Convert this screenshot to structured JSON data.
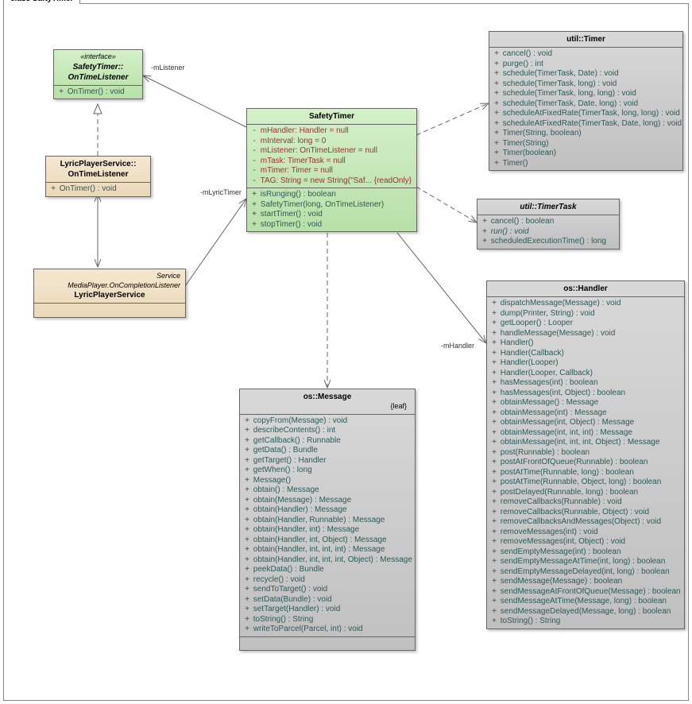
{
  "diagram_title": "class SaftyTimer",
  "classes": {
    "ontime": {
      "stereo": "«interface»",
      "name": "SafetyTimer::\nOnTimeListener",
      "ops": [
        "OnTimer() : void"
      ]
    },
    "lyriclistener": {
      "name": "LyricPlayerService::\nOnTimeListener",
      "ops": [
        "OnTimer() : void"
      ]
    },
    "safetytimer": {
      "name": "SafetyTimer",
      "attrs": [
        "mHandler:  Handler = null",
        "mInterval:  long = 0",
        "mListener:  OnTimeListener = null",
        "mTask:  TimerTask = null",
        "mTimer:  Timer = null",
        "TAG:  String = new String(\"Saf...  {readOnly}"
      ],
      "ops": [
        "isRunging() : boolean",
        "SafetyTimer(long, OnTimeListener)",
        "startTimer() : void",
        "stopTimer() : void"
      ]
    },
    "lyricservice": {
      "stereo": "Service\nMediaPlayer.OnCompletionListener",
      "name": "LyricPlayerService"
    },
    "timer": {
      "name": "util::Timer",
      "ops": [
        "cancel() : void",
        "purge() : int",
        "schedule(TimerTask, Date) : void",
        "schedule(TimerTask, long) : void",
        "schedule(TimerTask, long, long) : void",
        "schedule(TimerTask, Date, long) : void",
        "scheduleAtFixedRate(TimerTask, long, long) : void",
        "scheduleAtFixedRate(TimerTask, Date, long) : void",
        "Timer(String, boolean)",
        "Timer(String)",
        "Timer(boolean)",
        "Timer()"
      ]
    },
    "timertask": {
      "name": "util::TimerTask",
      "ops": [
        "cancel() : boolean",
        "run() : void",
        "scheduledExecutionTime() : long"
      ]
    },
    "handler": {
      "name": "os::Handler",
      "ops": [
        "dispatchMessage(Message) : void",
        "dump(Printer, String) : void",
        "getLooper() : Looper",
        "handleMessage(Message) : void",
        "Handler()",
        "Handler(Callback)",
        "Handler(Looper)",
        "Handler(Looper, Callback)",
        "hasMessages(int) : boolean",
        "hasMessages(int, Object) : boolean",
        "obtainMessage() : Message",
        "obtainMessage(int) : Message",
        "obtainMessage(int, Object) : Message",
        "obtainMessage(int, int, int) : Message",
        "obtainMessage(int, int, int, Object) : Message",
        "post(Runnable) : boolean",
        "postAtFrontOfQueue(Runnable) : boolean",
        "postAtTime(Runnable, long) : boolean",
        "postAtTime(Runnable, Object, long) : boolean",
        "postDelayed(Runnable, long) : boolean",
        "removeCallbacks(Runnable) : void",
        "removeCallbacks(Runnable, Object) : void",
        "removeCallbacksAndMessages(Object) : void",
        "removeMessages(int) : void",
        "removeMessages(int, Object) : void",
        "sendEmptyMessage(int) : boolean",
        "sendEmptyMessageAtTime(int, long) : boolean",
        "sendEmptyMessageDelayed(int, long) : boolean",
        "sendMessage(Message) : boolean",
        "sendMessageAtFrontOfQueue(Message) : boolean",
        "sendMessageAtTime(Message, long) : boolean",
        "sendMessageDelayed(Message, long) : boolean",
        "toString() : String"
      ]
    },
    "message": {
      "name": "os::Message",
      "leaf": "{leaf}",
      "ops": [
        "copyFrom(Message) : void",
        "describeContents() : int",
        "getCallback() : Runnable",
        "getData() : Bundle",
        "getTarget() : Handler",
        "getWhen() : long",
        "Message()",
        "obtain() : Message",
        "obtain(Message) : Message",
        "obtain(Handler) : Message",
        "obtain(Handler, Runnable) : Message",
        "obtain(Handler, int) : Message",
        "obtain(Handler, int, Object) : Message",
        "obtain(Handler, int, int, int) : Message",
        "obtain(Handler, int, int, int, Object) : Message",
        "peekData() : Bundle",
        "recycle() : void",
        "sendToTarget() : void",
        "setData(Bundle) : void",
        "setTarget(Handler) : void",
        "toString() : String",
        "writeToParcel(Parcel, int) : void"
      ]
    }
  },
  "labels": {
    "mListener": "-mListener",
    "mLyricTimer": "-mLyricTimer",
    "mHandler": "-mHandler"
  }
}
